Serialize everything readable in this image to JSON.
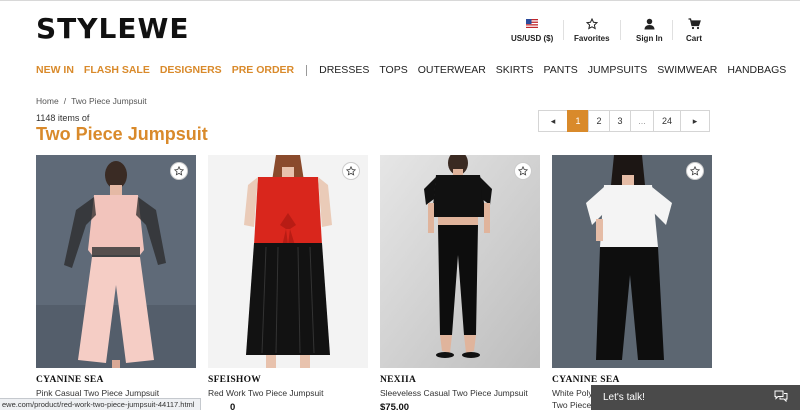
{
  "logo": "STYLEWE",
  "header": {
    "currency": "US/USD ($)",
    "favorites": "Favorites",
    "signin": "Sign In",
    "cart": "Cart"
  },
  "nav": {
    "promo": [
      "NEW IN",
      "FLASH SALE",
      "DESIGNERS",
      "PRE ORDER"
    ],
    "categories": [
      "DRESSES",
      "TOPS",
      "OUTERWEAR",
      "SKIRTS",
      "PANTS",
      "JUMPSUITS",
      "SWIMWEAR",
      "HANDBAGS"
    ]
  },
  "breadcrumb": {
    "home": "Home",
    "separator": "/",
    "current": "Two Piece Jumpsuit"
  },
  "listing": {
    "count": "1148 items of",
    "title": "Two Piece Jumpsuit"
  },
  "pagination": {
    "prev": "◂",
    "pages": [
      "1",
      "2",
      "3",
      "...",
      "24"
    ],
    "current": "1",
    "next": "▸"
  },
  "products": [
    {
      "brand": "CYANINE SEA",
      "name": "Pink Casual Two Piece Jumpsuit",
      "price": ""
    },
    {
      "brand": "SFEISHOW",
      "name": "Red Work Two Piece Jumpsuit",
      "price": "0"
    },
    {
      "brand": "NEXIIA",
      "name": "Sleeveless Casual Two Piece Jumpsuit",
      "price": "$75.00"
    },
    {
      "brand": "CYANINE SEA",
      "name": "White Polye",
      "name2": "Two Piece J",
      "price": ""
    }
  ],
  "statusbar": "ewe.com/product/red-work-two-piece-jumpsuit-44117.html",
  "chat": {
    "label": "Let's talk!"
  },
  "colors": {
    "accent": "#d98a2b",
    "chat_bg": "#4a4a4a"
  }
}
